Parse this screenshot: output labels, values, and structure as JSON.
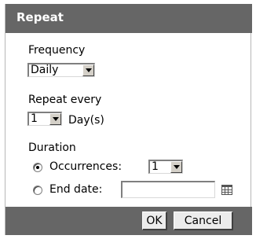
{
  "dialog": {
    "title": "Repeat",
    "frequency": {
      "label": "Frequency",
      "value": "Daily"
    },
    "repeat_every": {
      "label": "Repeat every",
      "value": "1",
      "unit": "Day(s)"
    },
    "duration": {
      "label": "Duration",
      "occurrences": {
        "label": "Occurrences:",
        "value": "1",
        "checked": true
      },
      "end_date": {
        "label": "End date:",
        "value": "",
        "checked": false
      }
    },
    "buttons": {
      "ok": "OK",
      "cancel": "Cancel"
    }
  },
  "colors": {
    "title_bar": "#666666",
    "footer_bar": "#666666",
    "button_face": "#ececec"
  },
  "icons": {
    "dropdown": "chevron-down-icon",
    "calendar": "calendar-icon"
  }
}
